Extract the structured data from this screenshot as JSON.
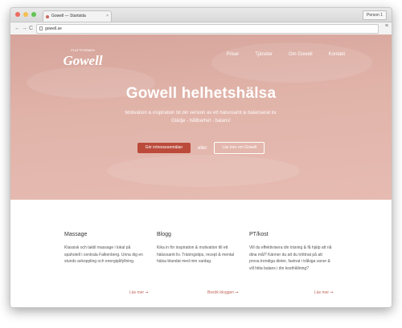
{
  "browser": {
    "tab_title": "Gowell — Startsida",
    "tab_close": "×",
    "profile": "Person 1",
    "url": "gowell.se",
    "nav_back": "←",
    "nav_forward": "→",
    "nav_reload": "C",
    "menu": "≡",
    "traffic_lights": [
      "#ed6a5e",
      "#f5bf4f",
      "#61c554"
    ]
  },
  "site": {
    "logo_top": "PLATTFORMEN",
    "logo_text": "Gowell",
    "nav": [
      "Priser",
      "Tjänster",
      "Om Gowell",
      "Kontakt"
    ],
    "hero": {
      "title": "Gowell helhetshälsa",
      "subtitle_line1": "Motivation & inspiration till din version av ett hälsosamt & balanserat liv.",
      "subtitle_line2": "Glädje - hållbarhet - balans!",
      "cta_primary": "Gör intresseanmälan",
      "cta_or": "eller",
      "cta_secondary": "Läs mer om Gowell"
    },
    "features": [
      {
        "title": "Massage",
        "text": "Klassisk och taktil massage i lokal på spahotell i centrala Falkenberg. Unna dig en stunds avkoppling och energipåfyllning.",
        "link": "Läs mer ➞"
      },
      {
        "title": "Blogg",
        "text": "Kika in för inspiration & motivation till ett hälsosamt liv. Träningstips, recept & mental hälsa blandat med min vardag.",
        "link": "Besök bloggen ➞"
      },
      {
        "title": "PT/kost",
        "text": "Vill du effektivisera din träning & få hjälp att nå dina mål? Känner du att du tröttnat på att prova trendiga dieter, fastnat i tråkiga vanor & vill hitta balans i din kosthållning?",
        "link": "Läs mer ➞"
      }
    ],
    "colors": {
      "hero": "#e1b4aa",
      "accent": "#bb4a3b",
      "link": "#c0685b"
    }
  }
}
